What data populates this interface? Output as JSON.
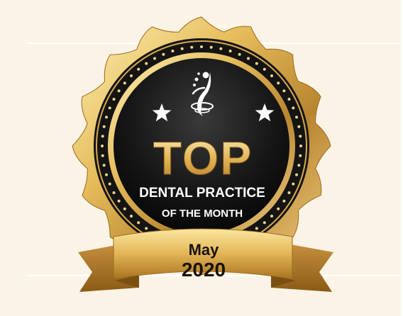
{
  "badge": {
    "headline": "TOP",
    "line1": "DENTAL PRACTICE",
    "line2": "OF THE MONTH",
    "month": "May",
    "year": "2020",
    "star_icon": "star-icon",
    "emblem_icon": "dancer-figure-icon"
  },
  "colors": {
    "gold_light": "#fbe9a6",
    "gold_mid": "#e0b552",
    "gold_dark": "#9b6a1d",
    "black": "#111111",
    "white": "#ffffff",
    "background": "#fbf3e6"
  }
}
